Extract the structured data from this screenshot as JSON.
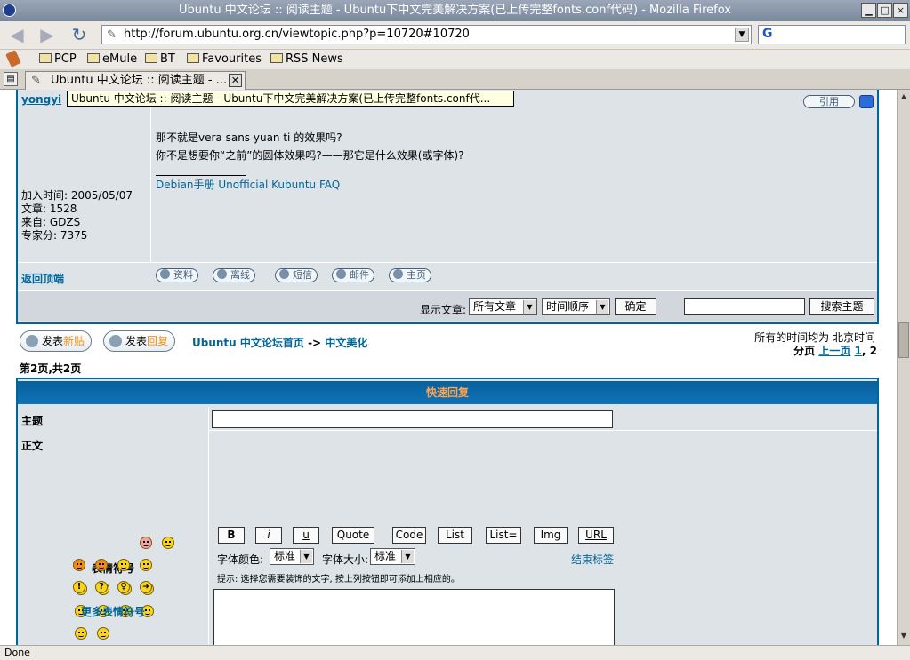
{
  "window": {
    "title": "Ubuntu 中文论坛 :: 阅读主题 - Ubuntu下中文完美解决方案(已上传完整fonts.conf代码) - Mozilla Firefox",
    "btn_min": "▁",
    "btn_max": "□",
    "btn_close": "×"
  },
  "nav": {
    "url": "http://forum.ubuntu.org.cn/viewtopic.php?p=10720#10720",
    "search_engine_glyph": "G"
  },
  "bookmarks": [
    "PCP",
    "eMule",
    "BT",
    "Favourites",
    "RSS News"
  ],
  "tab": {
    "label": "Ubuntu 中文论坛 :: 阅读主题 - ...",
    "tooltip": "Ubuntu 中文论坛 :: 阅读主题 - Ubuntu下中文完美解决方案(已上传完整fonts.conf代..."
  },
  "post": {
    "author": "yongyi",
    "quote_label": "引用",
    "line1": "那不就是vera sans yuan ti 的效果吗?",
    "line2": "你不是想要你“之前”的圆体效果吗?——那它是什么效果(或字体)?",
    "signature": "Debian手册 Unofficial Kubuntu FAQ",
    "userinfo": {
      "joined": "加入时间: 2005/05/07",
      "posts": "文章: 1528",
      "from": "来自: GDZS",
      "points": "专家分: 7375"
    },
    "back_to_top": "返回顶端",
    "actions": [
      "资料",
      "离线",
      "短信",
      "邮件",
      "主页"
    ]
  },
  "sortbar": {
    "label": "显示文章:",
    "filter": "所有文章",
    "order": "时间顺序",
    "ok": "确定",
    "search_btn": "搜索主题"
  },
  "topicnav": {
    "new_topic_prefix": "发表",
    "new_topic_hl": "新贴",
    "reply_prefix": "发表",
    "reply_hl": "回复",
    "forum_home": "Ubuntu 中文论坛首页",
    "arrow": "->",
    "subforum": "中文美化",
    "timezone": "所有的时间均为 北京时间",
    "pages_label": "分页",
    "prev": "上一页",
    "page1": "1",
    "page2": ", 2",
    "page_info": "第2页,共2页"
  },
  "quickreply": {
    "header": "快速回复",
    "subject_label": "主题",
    "body_label": "正文",
    "smilies_label": "表情符号",
    "more_smilies": "更多表情符号",
    "format_buttons": [
      "B",
      "i",
      "u",
      "Quote",
      "Code",
      "List",
      "List=",
      "Img",
      "URL"
    ],
    "font_color_label": "字体颜色:",
    "font_color": "标准",
    "font_size_label": "字体大小:",
    "font_size": "标准",
    "close_tags": "结束标签",
    "hint": "提示: 选择您需要装饰的文字, 按上列按钮即可添加上相应的。"
  },
  "status": "Done"
}
